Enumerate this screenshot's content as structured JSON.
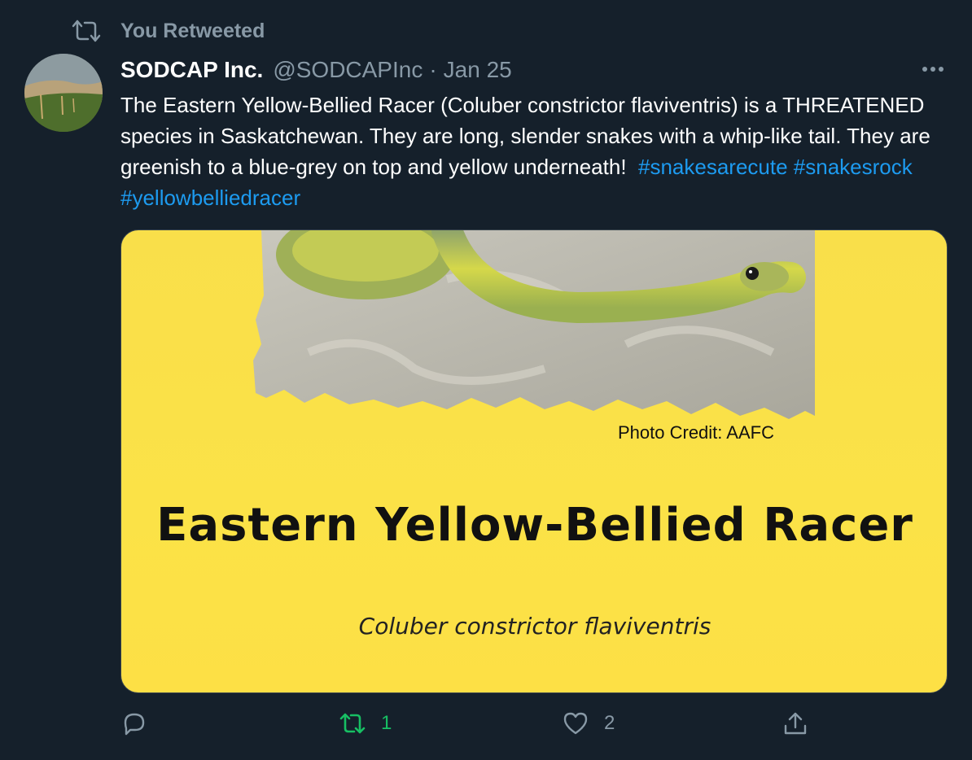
{
  "social_context": {
    "icon": "retweet-icon",
    "label": "You Retweeted"
  },
  "tweet": {
    "avatar_alt": "SODCAP Inc. avatar",
    "display_name": "SODCAP Inc.",
    "handle": "@SODCAPInc",
    "separator": "·",
    "date": "Jan 25",
    "text_plain": "The Eastern Yellow-Bellied Racer (Coluber constrictor flaviventris) is a THREATENED species in Saskatchewan.  They are long, slender snakes with a whip-like tail.  They are greenish to a blue-grey on top and yellow underneath!",
    "hashtags": [
      "#snakesarecute",
      "#snakesrock",
      "#yellowbelliedracer"
    ],
    "media": {
      "credit": "Photo Credit:  AAFC",
      "title": "Eastern Yellow-Bellied Racer",
      "scientific_name": "Coluber constrictor flaviventris",
      "background_color": "#fbe247"
    }
  },
  "actions": {
    "reply": {
      "icon": "reply-icon",
      "count": ""
    },
    "retweet": {
      "icon": "retweet-icon",
      "count": "1",
      "color": "#17bf63"
    },
    "like": {
      "icon": "heart-icon",
      "count": "2"
    },
    "share": {
      "icon": "share-icon",
      "count": ""
    }
  },
  "colors": {
    "background": "#15202b",
    "secondary_text": "#8899a6",
    "link": "#1d9bf0"
  }
}
